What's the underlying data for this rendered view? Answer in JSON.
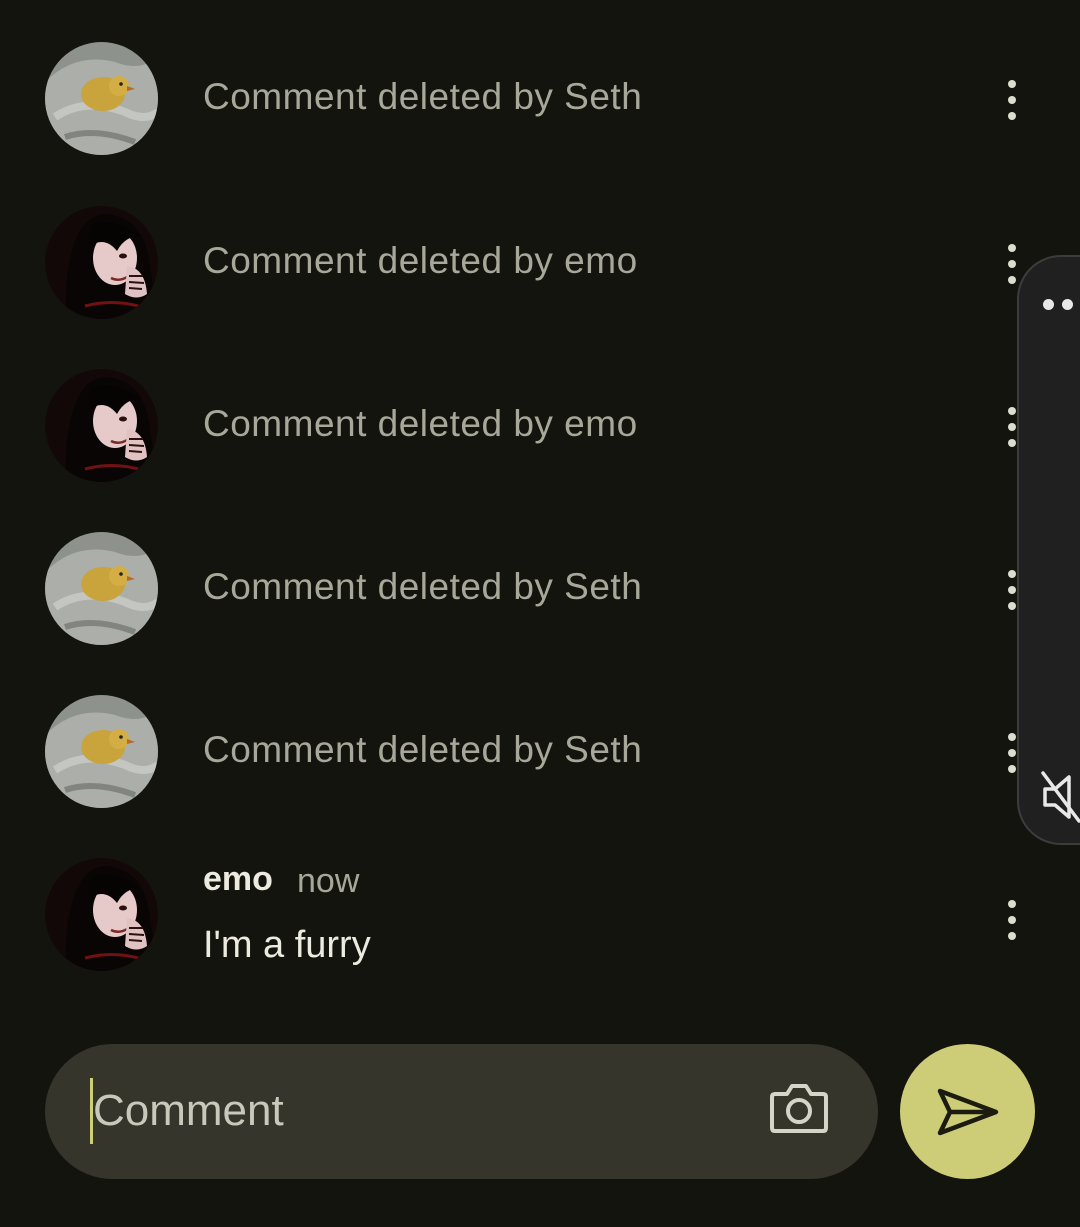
{
  "comments": [
    {
      "kind": "deleted",
      "text": "Comment deleted by Seth",
      "avatar": "duckling-avatar"
    },
    {
      "kind": "deleted",
      "text": "Comment deleted by emo",
      "avatar": "emo-avatar"
    },
    {
      "kind": "deleted",
      "text": "Comment deleted by emo",
      "avatar": "emo-avatar"
    },
    {
      "kind": "deleted",
      "text": "Comment deleted by Seth",
      "avatar": "duckling-avatar"
    },
    {
      "kind": "deleted",
      "text": "Comment deleted by Seth",
      "avatar": "duckling-avatar"
    },
    {
      "kind": "message",
      "author": "emo",
      "time": "now",
      "text": "I'm a furry",
      "avatar": "emo-avatar"
    }
  ],
  "composer": {
    "placeholder": "Comment",
    "value": ""
  },
  "icons": {
    "more": "more-vert-icon",
    "camera": "camera-icon",
    "send": "send-icon",
    "panel_more": "more-horiz-icon",
    "mute": "volume-off-icon"
  },
  "colors": {
    "background": "#14140e",
    "composer": "#35352c",
    "accent": "#cdcd78",
    "muted_text": "#a7a79a",
    "primary_text": "#ecebe0"
  }
}
